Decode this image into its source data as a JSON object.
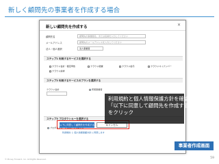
{
  "page": {
    "title": "新しく顧問先の事業者を作成する場合",
    "copyright": "© Money Forward, Inc. All Rights Reserved.",
    "page_number": "59",
    "tag": "事業者作成画面"
  },
  "dialog": {
    "title": "新しい顧問先を作成する",
    "close": "×",
    "fields": [
      {
        "label": "顧問先名",
        "placeholder": "顧問先の事業者名、または名前を入力してください"
      },
      {
        "label": "メールアドレス",
        "placeholder": "顧問先のメールアドレスを入力してください"
      },
      {
        "label": "法人・個人選択",
        "placeholder": "法人事業者"
      }
    ],
    "step1": {
      "title": "ステップ1 利用するサービスを選択する",
      "services": [
        "クラウド会計・確定申告",
        "クラウド経費",
        "クラウド給与",
        "クラウドマイナンバー",
        "クラウド請求"
      ]
    },
    "step2": {
      "title": "ステップ2 利用するサービスのプランを選択する",
      "plan_label": "クラウド会計",
      "plan_option": "所属事業者"
    },
    "step3": {
      "title": "ステップ3 プロダクトキーを選択する",
      "option": "プロダクトキーを使用せず登録する"
    },
    "primary_button": "以下に同意して顧問先を作成する",
    "cancel_button": "キャンセル",
    "consent_link": "利用規約 と 個人情報保護方針 に同意します"
  },
  "callout": {
    "lines": [
      "利用規約と個人情報保護方針を確認し",
      "「以下に同意して顧問先を作成する」",
      "をクリック"
    ]
  }
}
